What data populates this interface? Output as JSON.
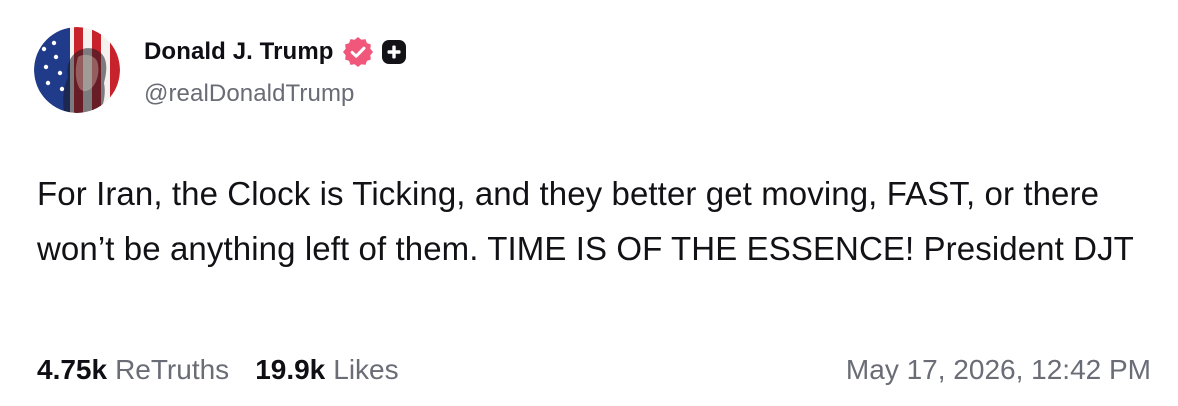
{
  "post": {
    "author": {
      "display_name": "Donald J. Trump",
      "handle": "@realDonaldTrump",
      "avatar_icon": "flag-portrait-avatar",
      "verified_icon": "verified-badge-icon",
      "verified_color": "#f0577b",
      "plus_icon": "plus-badge-icon"
    },
    "text": "For Iran, the Clock is Ticking, and they better get moving, FAST, or there won’t be anything left of them. TIME IS OF THE ESSENCE! President DJT",
    "stats": {
      "retruths_count": "4.75k",
      "retruths_label": "ReTruths",
      "likes_count": "19.9k",
      "likes_label": "Likes"
    },
    "timestamp": "May 17, 2026, 12:42 PM"
  }
}
